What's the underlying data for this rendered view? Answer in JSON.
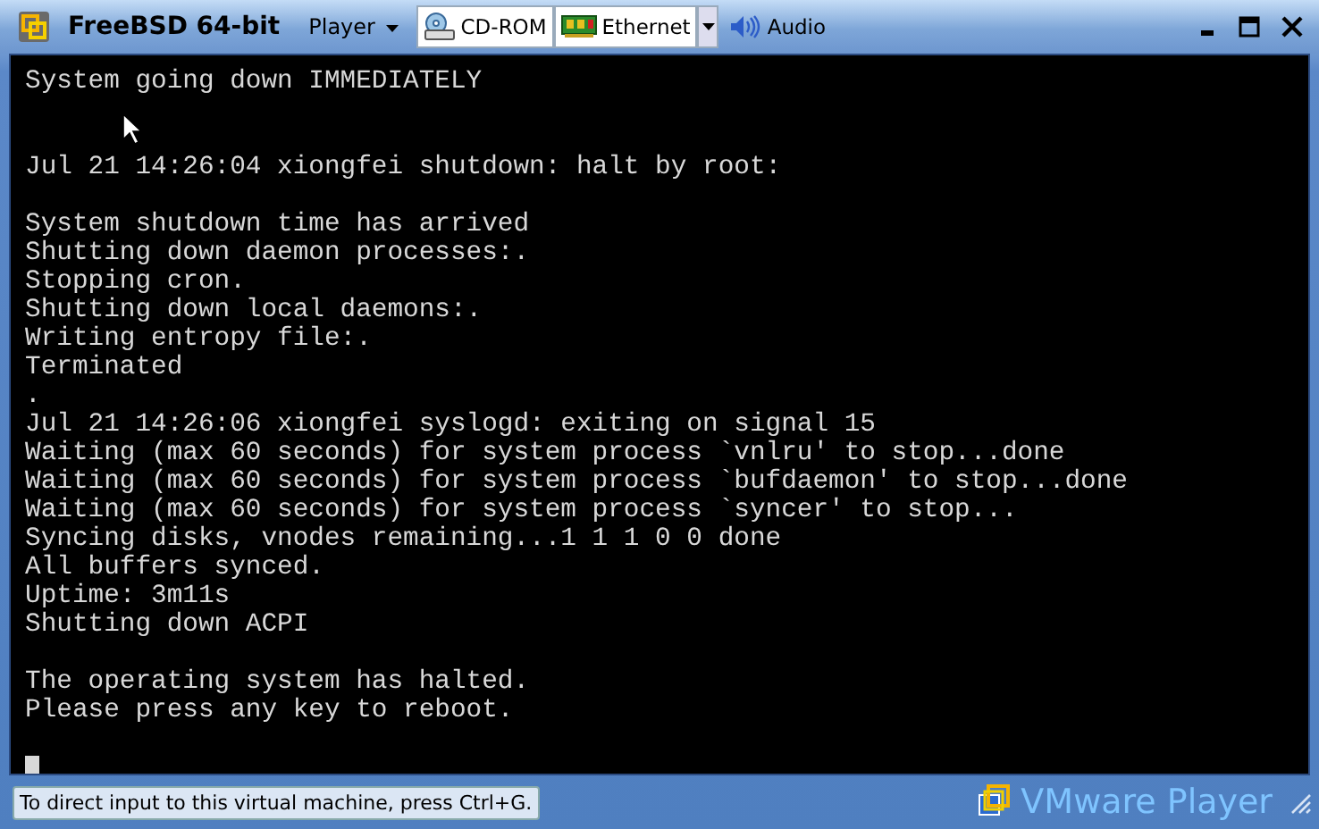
{
  "window": {
    "title": "FreeBSD 64-bit"
  },
  "menu": {
    "label": "Player"
  },
  "devices": [
    {
      "kind": "cdrom",
      "label": "CD-ROM",
      "connected": true,
      "has_menu": false
    },
    {
      "kind": "network",
      "label": "Ethernet",
      "connected": true,
      "has_menu": true
    },
    {
      "kind": "audio",
      "label": "Audio",
      "connected": false,
      "has_menu": false
    }
  ],
  "console": {
    "lines": [
      {
        "kind": "text",
        "text": "System going down IMMEDIATELY"
      },
      {
        "kind": "blank"
      },
      {
        "kind": "blank"
      },
      {
        "kind": "text",
        "text": "Jul 21 14:26:04 xiongfei shutdown: halt by root:"
      },
      {
        "kind": "blank"
      },
      {
        "kind": "text",
        "text": "System shutdown time has arrived"
      },
      {
        "kind": "text",
        "text": "Shutting down daemon processes:."
      },
      {
        "kind": "text",
        "text": "Stopping cron."
      },
      {
        "kind": "text",
        "text": "Shutting down local daemons:."
      },
      {
        "kind": "text",
        "text": "Writing entropy file:."
      },
      {
        "kind": "text",
        "text": "Terminated"
      },
      {
        "kind": "text",
        "text": "."
      },
      {
        "kind": "text",
        "text": "Jul 21 14:26:06 xiongfei syslogd: exiting on signal 15"
      },
      {
        "kind": "text",
        "text": "Waiting (max 60 seconds) for system process `vnlru' to stop...done"
      },
      {
        "kind": "text",
        "text": "Waiting (max 60 seconds) for system process `bufdaemon' to stop...done"
      },
      {
        "kind": "text",
        "text": "Waiting (max 60 seconds) for system process `syncer' to stop..."
      },
      {
        "kind": "text",
        "text": "Syncing disks, vnodes remaining...1 1 1 0 0 done"
      },
      {
        "kind": "text",
        "text": "All buffers synced."
      },
      {
        "kind": "text",
        "text": "Uptime: 3m11s"
      },
      {
        "kind": "text",
        "text": "Shutting down ACPI"
      },
      {
        "kind": "blank"
      },
      {
        "kind": "text",
        "text": "The operating system has halted."
      },
      {
        "kind": "text",
        "text": "Please press any key to reboot."
      },
      {
        "kind": "blank"
      },
      {
        "kind": "cursor"
      }
    ]
  },
  "status_bar": {
    "hint": "To direct input to this virtual machine, press Ctrl+G.",
    "brand": "VMware Player"
  }
}
